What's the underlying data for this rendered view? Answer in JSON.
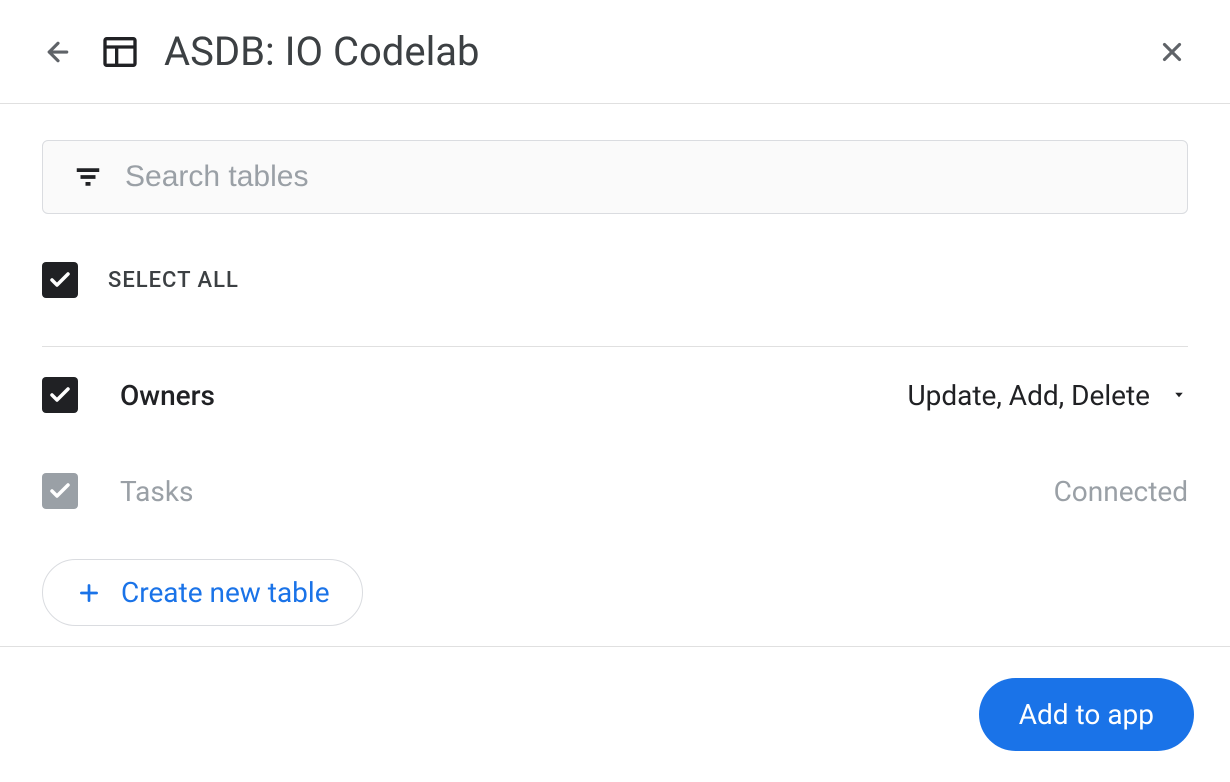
{
  "header": {
    "title": "ASDB: IO Codelab",
    "icons": {
      "back": "arrow-left",
      "table": "table-grid",
      "close": "x"
    }
  },
  "search": {
    "placeholder": "Search tables",
    "value": "",
    "icon": "filter"
  },
  "select_all": {
    "checked": true,
    "label": "SELECT ALL"
  },
  "tables": [
    {
      "name": "Owners",
      "checked": true,
      "enabled": true,
      "permissions": "Update, Add, Delete",
      "status": ""
    },
    {
      "name": "Tasks",
      "checked": true,
      "enabled": false,
      "permissions": "",
      "status": "Connected"
    }
  ],
  "create_button": {
    "label": "Create new table",
    "icon": "plus"
  },
  "footer": {
    "add_button_label": "Add to app"
  },
  "colors": {
    "primary": "#1a73e8",
    "text": "#202124",
    "muted": "#9aa0a6",
    "border": "#e0e0e0"
  }
}
